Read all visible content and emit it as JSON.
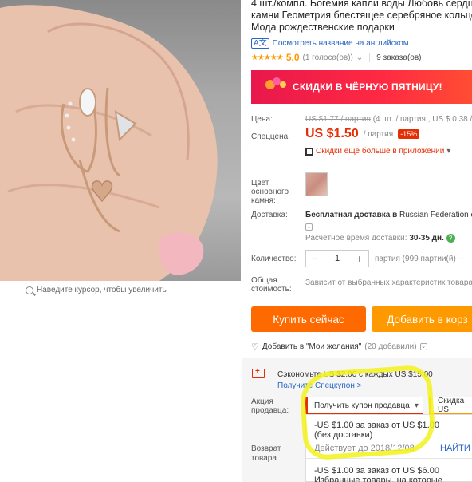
{
  "image": {
    "zoom_hint": "Наведите курсор, чтобы увеличить"
  },
  "product": {
    "title_line1": "4 шт./компл. Богемия капли воды Любовь сердц",
    "title_line2": "камни Геометрия блестящее серебряное кольцо",
    "title_line3": "Мода рождественские подарки",
    "translate_link": "Посмотреть название на английском",
    "rating_score": "5.0",
    "rating_votes": "(1 голоса(ов))",
    "orders": "9 заказа(ов)"
  },
  "banner": {
    "text": "СКИДКИ В ЧЁРНУЮ ПЯТНИЦУ!",
    "colors": [
      "#e8184c",
      "#ff4d33"
    ]
  },
  "price": {
    "label": "Цена:",
    "old_value": "US $1.77 / партия",
    "old_note": "(4 шт. / партия , US $ 0.38 /",
    "special_label": "Спеццена:",
    "new_value": "US $1.50",
    "per": "/ партия",
    "discount": "-15%",
    "app_link": "Скидки ещё больше в приложении"
  },
  "options": {
    "color_label_1": "Цвет",
    "color_label_2": "основного",
    "color_label_3": "камня:",
    "shipping_label": "Доставка:",
    "shipping_value_bold": "Бесплатная доставка в",
    "shipping_value": "Russian Federation с",
    "delivery_time_label": "Расчётное время доставки:",
    "delivery_time_value": "30-35 дн.",
    "qty_label": "Количество:",
    "qty_minus": "−",
    "qty_value": "1",
    "qty_plus": "+",
    "qty_note": "партия (999 партии(й) —",
    "total_label_1": "Общая",
    "total_label_2": "стоимость:",
    "total_value": "Зависит от выбранных характеристик товара"
  },
  "actions": {
    "buy_now": "Купить сейчас",
    "add_to_cart": "Добавить в корз",
    "wishlist": "Добавить в \"Мои желания\"",
    "wishlist_count": "(20 добавили)"
  },
  "coupons": {
    "save_text": "Сэкономьте US $2.00 с каждых US $15.00",
    "get_special": "Получите Спецкупон >",
    "seller_label_1": "Акция",
    "seller_label_2": "продавца:",
    "get_seller_coupon": "Получить купон продавца",
    "discount_box": "Скидка US",
    "coupon1_line1": "-US $1.00 за заказ от US $1.00",
    "coupon1_line2": "(без доставки)",
    "coupon1_valid": "Действует до 2018/12/08",
    "find_more": "НАЙТИ И",
    "coupon2_line1": "-US $1.00 за заказ от US $6.00",
    "coupon2_line2": "Избранные товары, на которые",
    "return_label_1": "Возврат",
    "return_label_2": "товара"
  }
}
